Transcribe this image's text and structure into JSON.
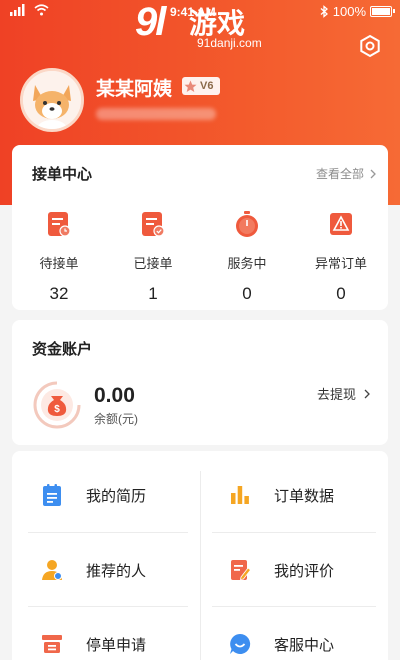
{
  "status_bar": {
    "time": "9:41 AM",
    "battery": "100%"
  },
  "watermark": {
    "logo": "9l",
    "name": "游戏",
    "url": "91danji.com"
  },
  "profile": {
    "name": "某某阿姨",
    "level": "V6"
  },
  "orders": {
    "title": "接单中心",
    "view_all": "查看全部",
    "stats": [
      {
        "label": "待接单",
        "value": "32",
        "icon": "pending-order-icon"
      },
      {
        "label": "已接单",
        "value": "1",
        "icon": "accepted-order-icon"
      },
      {
        "label": "服务中",
        "value": "0",
        "icon": "in-service-clock-icon"
      },
      {
        "label": "异常订单",
        "value": "0",
        "icon": "warning-order-icon"
      }
    ]
  },
  "fund": {
    "title": "资金账户",
    "balance": "0.00",
    "balance_label": "余额(元)",
    "withdraw": "去提现"
  },
  "menu": [
    {
      "label": "我的简历",
      "icon": "resume-icon"
    },
    {
      "label": "订单数据",
      "icon": "bar-chart-icon"
    },
    {
      "label": "推荐的人",
      "icon": "referral-person-icon"
    },
    {
      "label": "我的评价",
      "icon": "review-edit-icon"
    },
    {
      "label": "停单申请",
      "icon": "pause-order-icon"
    },
    {
      "label": "客服中心",
      "icon": "customer-service-icon"
    }
  ],
  "colors": {
    "brand": "#f04a26",
    "accent_orange": "#f5a623",
    "icon_blue": "#3d8ef0"
  }
}
